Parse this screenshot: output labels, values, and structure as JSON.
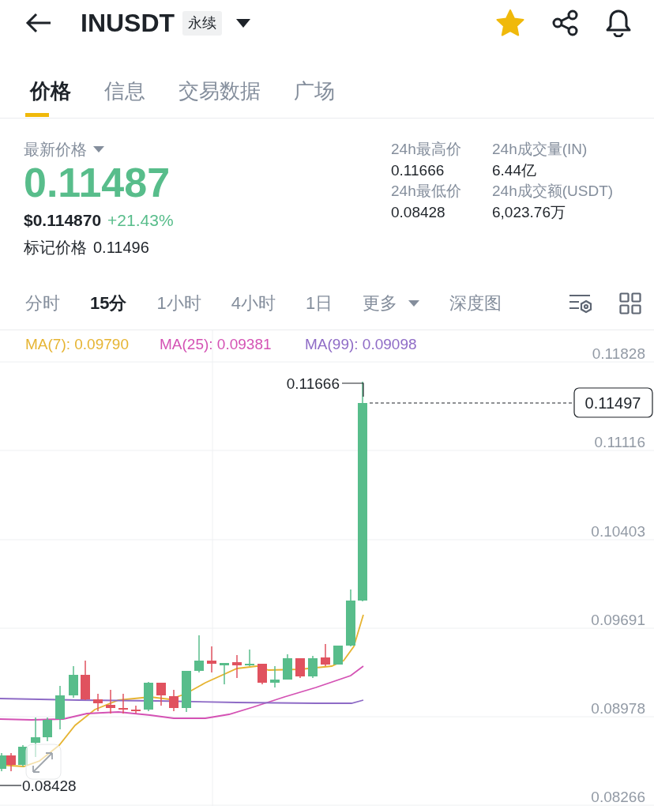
{
  "header": {
    "symbol": "INUSDT",
    "contract_badge": "永续",
    "favorite": true
  },
  "tabs": [
    {
      "label": "价格",
      "selected": true
    },
    {
      "label": "信息",
      "selected": false
    },
    {
      "label": "交易数据",
      "selected": false
    },
    {
      "label": "广场",
      "selected": false
    }
  ],
  "price": {
    "label": "最新价格",
    "last": "0.11487",
    "usd": "$0.114870",
    "change": "+21.43%",
    "mark_label": "标记价格",
    "mark_value": "0.11496"
  },
  "stats": [
    {
      "label": "24h最高价",
      "value": "0.11666"
    },
    {
      "label": "24h成交量(IN)",
      "value": "6.44亿"
    },
    {
      "label": "24h最低价",
      "value": "0.08428"
    },
    {
      "label": "24h成交额(USDT)",
      "value": "6,023.76万"
    }
  ],
  "intervals": [
    {
      "label": "分时",
      "selected": false,
      "kind": "tab"
    },
    {
      "label": "15分",
      "selected": true,
      "kind": "tab"
    },
    {
      "label": "1小时",
      "selected": false,
      "kind": "tab"
    },
    {
      "label": "4小时",
      "selected": false,
      "kind": "tab"
    },
    {
      "label": "1日",
      "selected": false,
      "kind": "tab"
    },
    {
      "label": "更多",
      "selected": false,
      "kind": "menu"
    },
    {
      "label": "深度图",
      "selected": false,
      "kind": "tab"
    }
  ],
  "chart": {
    "indicators": [
      {
        "label": "MA(7): 0.09790",
        "color": "#e6b432"
      },
      {
        "label": "MA(25): 0.09381",
        "color": "#d452b4"
      },
      {
        "label": "MA(99): 0.09098",
        "color": "#8e6bc6"
      }
    ],
    "price_ticks": [
      "0.11828",
      "0.11116",
      "0.10403",
      "0.09691",
      "0.08978",
      "0.08266"
    ],
    "high_marker": "0.11666",
    "low_marker": "0.08428",
    "last_price": "0.11497"
  }
}
